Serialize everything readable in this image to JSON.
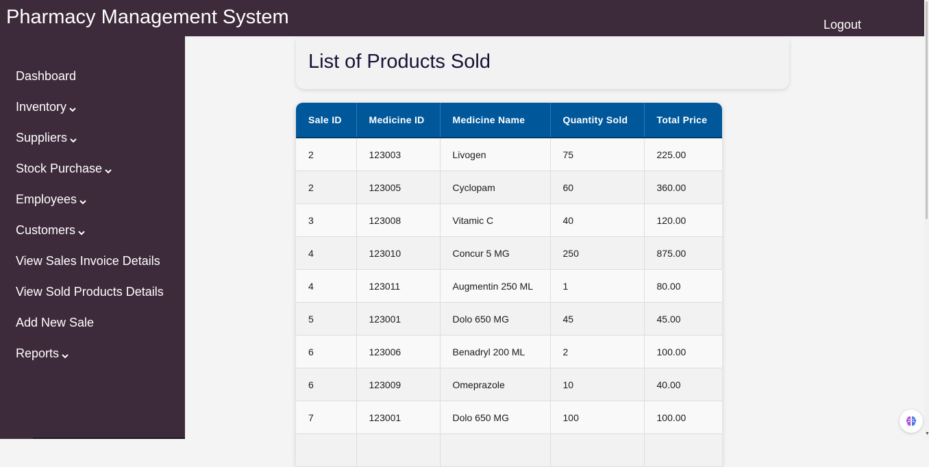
{
  "header": {
    "app_title": "Pharmacy Management System",
    "logout_label": "Logout"
  },
  "sidebar": {
    "items": [
      {
        "label": "Dashboard",
        "has_dropdown": false
      },
      {
        "label": "Inventory",
        "has_dropdown": true
      },
      {
        "label": "Suppliers",
        "has_dropdown": true
      },
      {
        "label": "Stock Purchase",
        "has_dropdown": true
      },
      {
        "label": "Employees",
        "has_dropdown": true
      },
      {
        "label": "Customers",
        "has_dropdown": true
      },
      {
        "label": "View Sales Invoice Details",
        "has_dropdown": false
      },
      {
        "label": "View Sold Products Details",
        "has_dropdown": false
      },
      {
        "label": "Add New Sale",
        "has_dropdown": false
      },
      {
        "label": "Reports",
        "has_dropdown": true
      }
    ]
  },
  "main": {
    "page_title": "List of Products Sold",
    "table": {
      "columns": [
        "Sale ID",
        "Medicine ID",
        "Medicine Name",
        "Quantity Sold",
        "Total Price"
      ],
      "rows": [
        [
          "2",
          "123003",
          "Livogen",
          "75",
          "225.00"
        ],
        [
          "2",
          "123005",
          "Cyclopam",
          "60",
          "360.00"
        ],
        [
          "3",
          "123008",
          "Vitamic C",
          "40",
          "120.00"
        ],
        [
          "4",
          "123010",
          "Concur 5 MG",
          "250",
          "875.00"
        ],
        [
          "4",
          "123011",
          "Augmentin 250 ML",
          "1",
          "80.00"
        ],
        [
          "5",
          "123001",
          "Dolo 650 MG",
          "45",
          "45.00"
        ],
        [
          "6",
          "123006",
          "Benadryl 200 ML",
          "2",
          "100.00"
        ],
        [
          "6",
          "123009",
          "Omeprazole",
          "10",
          "40.00"
        ],
        [
          "7",
          "123001",
          "Dolo 650 MG",
          "100",
          "100.00"
        ]
      ]
    }
  },
  "colors": {
    "header_bg": "#3d2a3a",
    "sidebar_bg": "#3d2a3a",
    "table_header_bg": "#00589b",
    "page_bg": "#f4f4f4"
  }
}
